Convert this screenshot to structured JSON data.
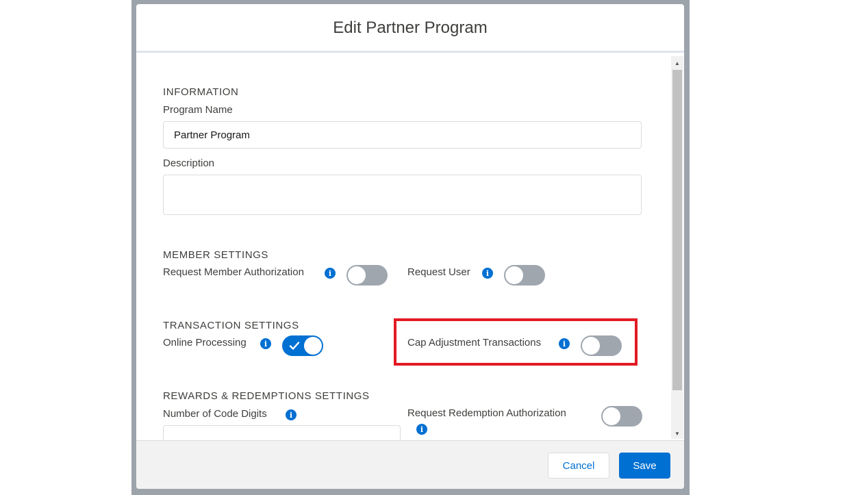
{
  "modal": {
    "title": "Edit Partner Program"
  },
  "information": {
    "section_title": "INFORMATION",
    "program_name_label": "Program Name",
    "program_name_value": "Partner Program",
    "description_label": "Description",
    "description_value": ""
  },
  "member_settings": {
    "section_title": "MEMBER SETTINGS",
    "request_member_authorization_label": "Request Member Authorization",
    "request_member_authorization_on": false,
    "request_user_label": "Request User",
    "request_user_on": false
  },
  "transaction_settings": {
    "section_title": "TRANSACTION SETTINGS",
    "online_processing_label": "Online Processing",
    "online_processing_on": true,
    "cap_adjustment_transactions_label": "Cap Adjustment Transactions",
    "cap_adjustment_transactions_on": false
  },
  "rewards_settings": {
    "section_title": "REWARDS & REDEMPTIONS SETTINGS",
    "number_of_code_digits_label": "Number of Code Digits",
    "number_of_code_digits_value": "",
    "request_redemption_authorization_label": "Request Redemption Authorization",
    "request_redemption_authorization_on": false
  },
  "footer": {
    "cancel_label": "Cancel",
    "save_label": "Save"
  },
  "icons": {
    "info": "info-icon",
    "check": "check-icon",
    "scroll_up": "scroll-up-arrow-icon",
    "scroll_down": "scroll-down-arrow-icon"
  },
  "colors": {
    "brand": "#0070d2",
    "toggle_off": "#9fa6ae",
    "highlight": "#e21a23"
  }
}
